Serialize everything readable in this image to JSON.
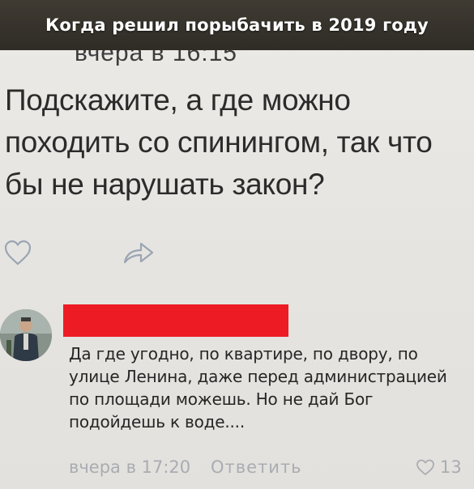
{
  "banner": {
    "title": "Когда решил порыбачить в 2019 году"
  },
  "post": {
    "timestamp": "вчера в 16:15",
    "text": "Подскажите, а где можно походить со спинингом, так что бы не нарушать закон?"
  },
  "comment": {
    "text": "Да где угодно, по квартире, по двору, по улице Ленина, даже перед администрацией по площади можешь. Но не дай Бог подойдешь к воде....",
    "time": "вчера в 17:20",
    "reply_label": "Ответить",
    "likes": "13"
  },
  "colors": {
    "banner": "#2f2c26",
    "redaction": "#ed1c24",
    "meta": "#a9acb2",
    "icon": "#9aa5b3"
  }
}
